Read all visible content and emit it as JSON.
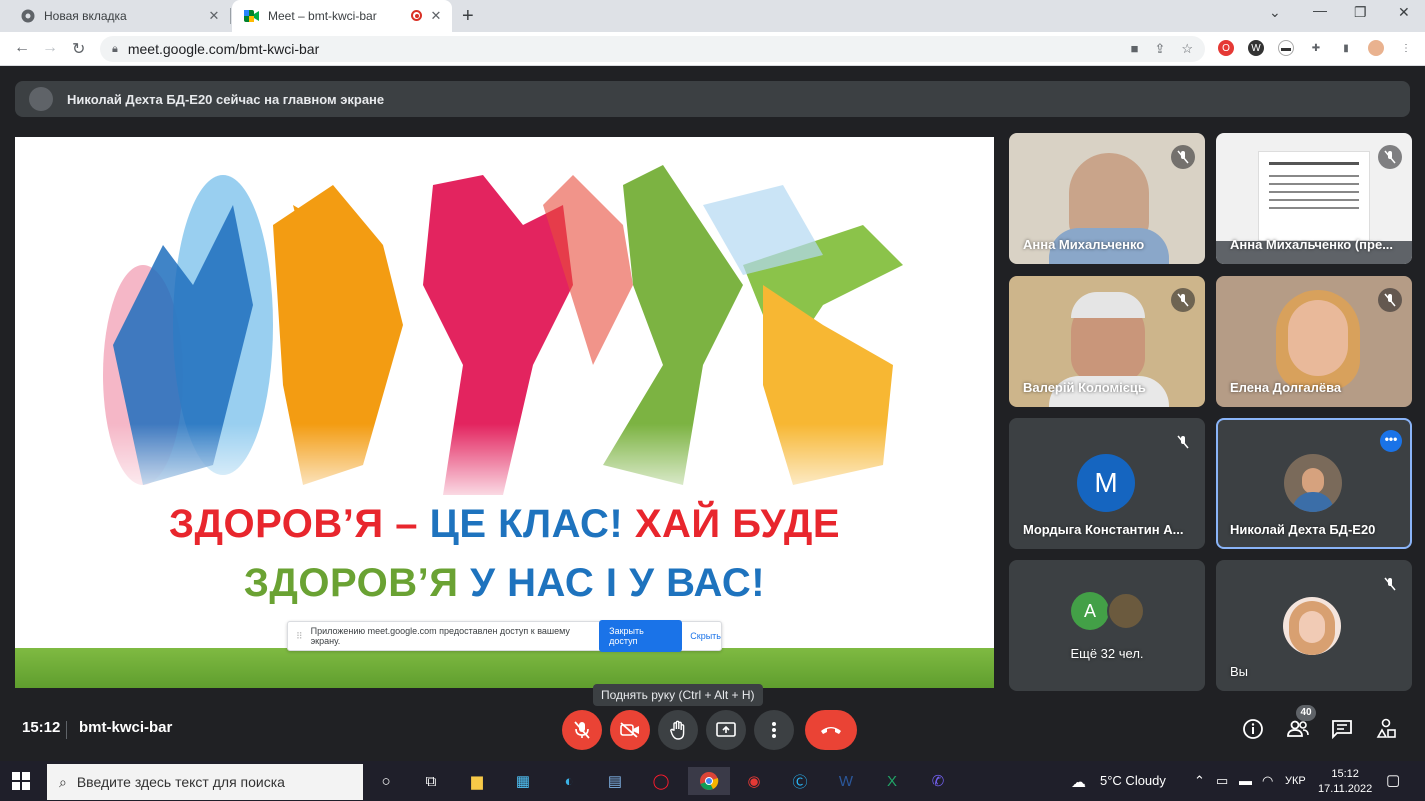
{
  "browser": {
    "tabs": [
      {
        "title": "Новая вкладка",
        "favicon": "chrome-icon"
      },
      {
        "title": "Meet – bmt-kwci-bar",
        "favicon": "meet-icon",
        "active": true
      }
    ],
    "new_tab": "+",
    "url": "meet.google.com/bmt-kwci-bar"
  },
  "meet": {
    "banner": "Николай Дехта БД-Е20 сейчас на главном экране",
    "presentation": {
      "line1_a": "ЗДОРОВ’Я – ",
      "line1_b": "ЦЕ КЛАС! ",
      "line1_c": "ХАЙ БУДЕ",
      "line2_a": "ЗДОРОВ’Я ",
      "line2_b": "У НАС І У ВАС!",
      "colors": {
        "red": "#e8262d",
        "blue": "#1e73be",
        "green": "#6aa233"
      }
    },
    "share_bar": {
      "grip": "⠿",
      "message": "Приложению meet.google.com предоставлен доступ к вашему экрану.",
      "stop": "Закрыть доступ",
      "hide": "Скрыть"
    },
    "participants": [
      {
        "name": "Анна Михальченко"
      },
      {
        "name": "Анна Михальченко (пре..."
      },
      {
        "name": "Валерій Коломієць"
      },
      {
        "name": "Елена Долгалёва"
      },
      {
        "name": "Мордыга Константин А...",
        "initial": "М"
      },
      {
        "name": "Николай Дехта БД-Е20"
      },
      {
        "name": "Ещё 32 чел.",
        "initial": "А"
      },
      {
        "name": "Вы"
      }
    ],
    "tooltip": "Поднять руку (Ctrl + Alt + H)",
    "time": "15:12",
    "meeting_code": "bmt-kwci-bar",
    "people_count": "40"
  },
  "taskbar": {
    "search_placeholder": "Введите здесь текст для поиска",
    "weather": "5°C  Cloudy",
    "lang": "УКР",
    "clock_time": "15:12",
    "clock_date": "17.11.2022"
  }
}
